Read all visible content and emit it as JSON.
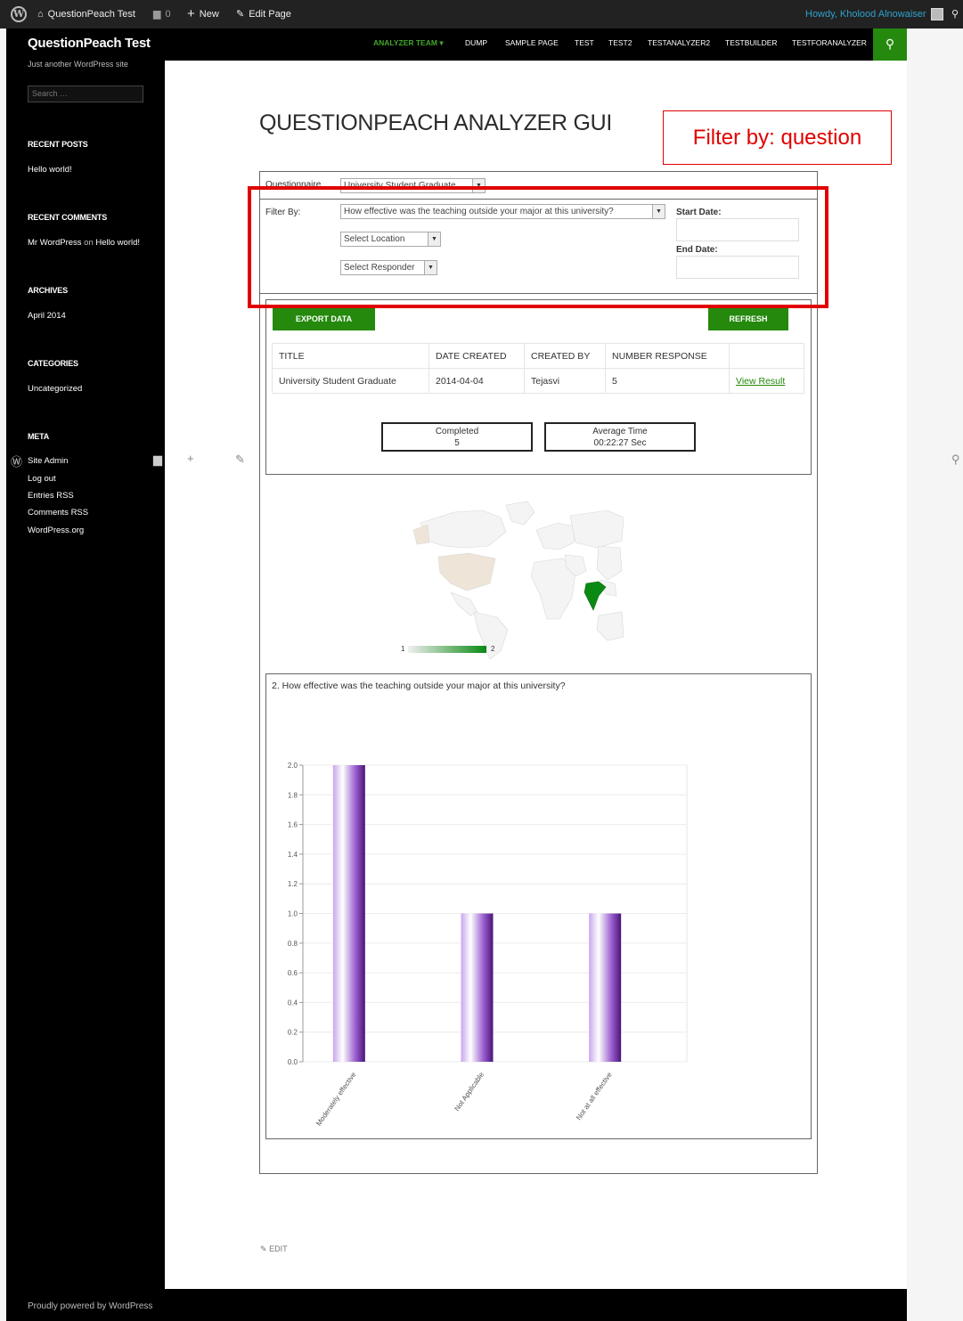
{
  "admin_bar": {
    "site_name": "QuestionPeach Test",
    "comments_count": "0",
    "new_label": "New",
    "edit_page_label": "Edit Page",
    "greeting": "Howdy, Kholood Alnowaiser"
  },
  "site": {
    "title": "QuestionPeach Test",
    "tagline": "Just another WordPress site",
    "search_placeholder": "Search …",
    "footer": "Proudly powered by WordPress"
  },
  "nav": {
    "items": [
      "ANALYZER TEAM",
      "DUMP",
      "SAMPLE PAGE",
      "TEST",
      "TEST2",
      "TESTANALYZER2",
      "TESTBUILDER",
      "TESTFORANALYZER"
    ],
    "active_index": 0
  },
  "sidebar": {
    "recent_posts_title": "RECENT POSTS",
    "recent_posts": [
      "Hello world!"
    ],
    "recent_comments_title": "RECENT COMMENTS",
    "comment_author": "Mr WordPress",
    "comment_on": "on",
    "comment_post": "Hello world!",
    "archives_title": "ARCHIVES",
    "archives": [
      "April 2014"
    ],
    "categories_title": "CATEGORIES",
    "categories": [
      "Uncategorized"
    ],
    "meta_title": "META",
    "meta": [
      "Site Admin",
      "Log out",
      "Entries RSS",
      "Comments RSS",
      "WordPress.org"
    ]
  },
  "page": {
    "heading": "QUESTIONPEACH ANALYZER GUI",
    "annotation": "Filter by: question",
    "questionnaire_label": "Questionnaire",
    "questionnaire_value": "University Student Graduate",
    "filter_by_label": "Filter By:",
    "question_select": "How effective was the teaching outside your major at this university?",
    "location_select": "Select Location",
    "responder_select": "Select Responder",
    "start_date_label": "Start Date:",
    "end_date_label": "End Date:",
    "export_label": "EXPORT DATA",
    "refresh_label": "REFRESH",
    "edit_label": "EDIT"
  },
  "results_table": {
    "headers": [
      "TITLE",
      "DATE CREATED",
      "CREATED BY",
      "NUMBER RESPONSE",
      ""
    ],
    "rows": [
      {
        "title": "University Student Graduate",
        "date": "2014-04-04",
        "by": "Tejasvi",
        "count": "5",
        "link": "View Result"
      }
    ]
  },
  "stats": {
    "completed_label": "Completed",
    "completed_value": "5",
    "avg_label": "Average Time",
    "avg_value": "00:22:27 Sec"
  },
  "map_legend": {
    "min": "1",
    "max": "2",
    "low_color": "#f0f0f0",
    "high_color": "#0a8a13"
  },
  "colors": {
    "accent_green": "#24890d",
    "annotation_red": "#e00000",
    "bar_purple": "#7b3fb0"
  },
  "chart_data": {
    "type": "bar",
    "title": "2. How effective was the teaching outside your major at this university?",
    "categories": [
      "Moderately effective",
      "Not Applicable",
      "Not at all effective"
    ],
    "values": [
      2,
      1,
      1
    ],
    "ylim": [
      0,
      2.0
    ],
    "yticks": [
      "0.0",
      "0.2",
      "0.4",
      "0.6",
      "0.8",
      "1.0",
      "1.2",
      "1.4",
      "1.6",
      "1.8",
      "2.0"
    ],
    "grid": true
  }
}
